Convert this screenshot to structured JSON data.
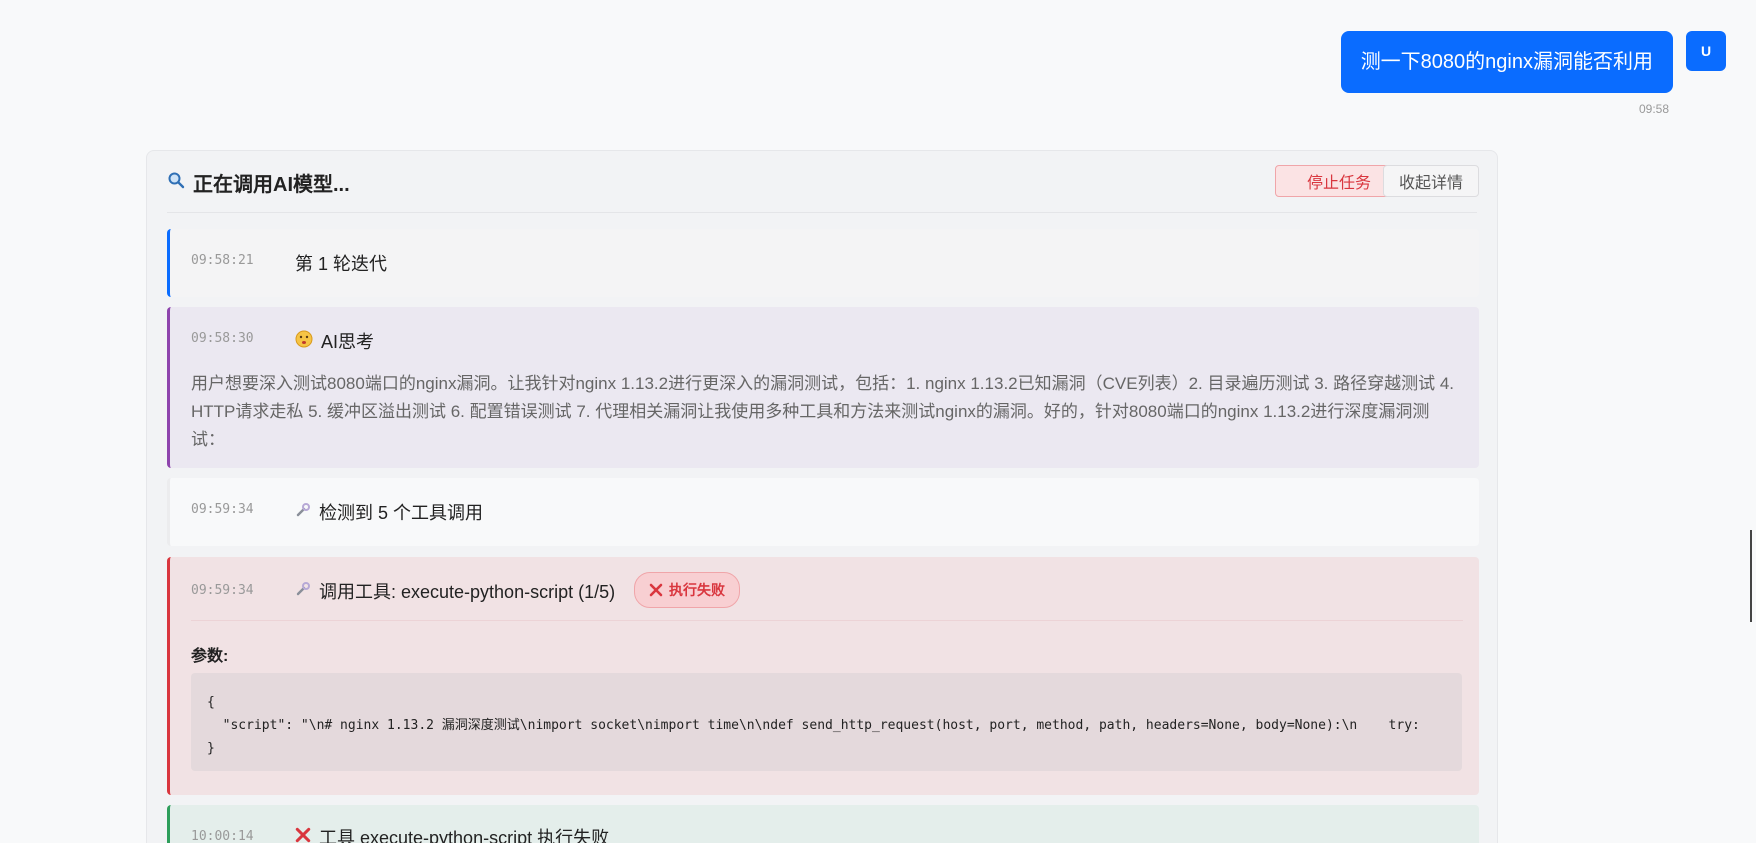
{
  "user_message": {
    "text": "测一下8080的nginx漏洞能否利用",
    "time": "09:58",
    "avatar": "U"
  },
  "panel": {
    "icon": "search-icon",
    "title": "正在调用AI模型...",
    "stop_button": "停止任务",
    "collapse_button": "收起详情"
  },
  "entries": [
    {
      "time": "09:58:21",
      "label": "第 1 轮迭代"
    },
    {
      "time": "09:58:30",
      "icon": "thinking-face-icon",
      "label": "AI思考",
      "body": "用户想要深入测试8080端口的nginx漏洞。让我针对nginx 1.13.2进行更深入的漏洞测试，包括：1. nginx 1.13.2已知漏洞（CVE列表）2. 目录遍历测试 3. 路径穿越测试 4. HTTP请求走私 5. 缓冲区溢出测试 6. 配置错误测试 7. 代理相关漏洞让我使用多种工具和方法来测试nginx的漏洞。好的，针对8080端口的nginx 1.13.2进行深度漏洞测试："
    },
    {
      "time": "09:59:34",
      "icon": "wrench-icon",
      "label": "检测到 5 个工具调用"
    },
    {
      "time": "09:59:34",
      "icon": "wrench-icon",
      "label": "调用工具: execute-python-script (1/5)",
      "status": "执行失败",
      "params_label": "参数:",
      "code_line1": "{",
      "code_line2": "  \"script\": \"\\n# nginx 1.13.2 漏洞深度测试\\nimport socket\\nimport time\\n\\ndef send_http_request(host, port, method, path, headers=None, body=None):\\n    try:",
      "code_line3": "}"
    },
    {
      "time": "10:00:14",
      "icon": "cross-mark-icon",
      "label": "工具 execute-python-script 执行失败"
    }
  ],
  "colors": {
    "accent": "#0a6cff",
    "error": "#d9363e",
    "thinking": "#8e44ad",
    "success": "#2e9e5b"
  }
}
